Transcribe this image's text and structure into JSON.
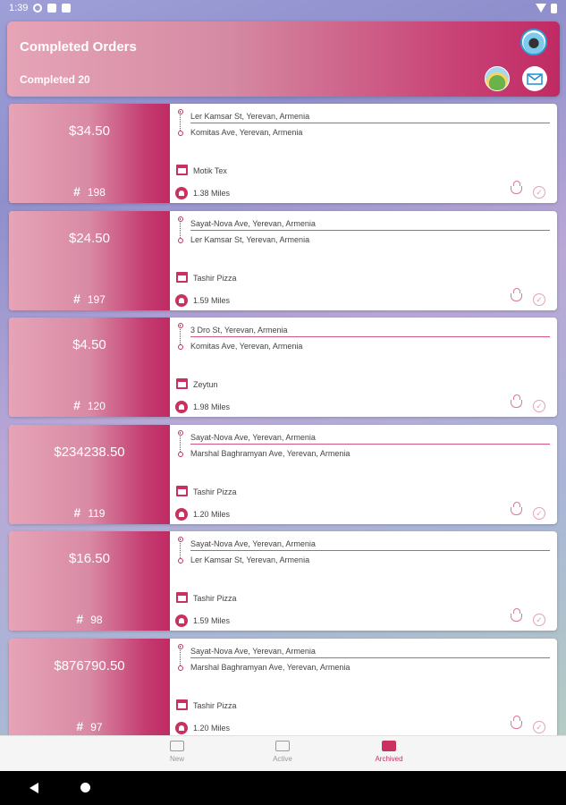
{
  "status_bar": {
    "time": "1:39"
  },
  "header": {
    "title": "Completed Orders",
    "completed_label": "Completed 20"
  },
  "orders": [
    {
      "price": "$34.50",
      "number": "198",
      "from": "Ler Kamsar St, Yerevan, Armenia",
      "to": "Komitas Ave, Yerevan, Armenia",
      "store": "Motik Tex",
      "distance": "1.38 Miles"
    },
    {
      "price": "$24.50",
      "number": "197",
      "from": "Sayat-Nova Ave, Yerevan, Armenia",
      "to": "Ler Kamsar St, Yerevan, Armenia",
      "store": "Tashir Pizza",
      "distance": "1.59 Miles"
    },
    {
      "price": "$4.50",
      "number": "120",
      "from": "3 Dro St, Yerevan, Armenia",
      "to": "Komitas Ave, Yerevan, Armenia",
      "store": "Zeytun",
      "distance": "1.98 Miles"
    },
    {
      "price": "$234238.50",
      "number": "119",
      "from": "Sayat-Nova Ave, Yerevan, Armenia",
      "to": "Marshal Baghramyan Ave, Yerevan, Armenia",
      "store": "Tashir Pizza",
      "distance": "1.20 Miles"
    },
    {
      "price": "$16.50",
      "number": "98",
      "from": "Sayat-Nova Ave, Yerevan, Armenia",
      "to": "Ler Kamsar St, Yerevan, Armenia",
      "store": "Tashir Pizza",
      "distance": "1.59 Miles"
    },
    {
      "price": "$876790.50",
      "number": "97",
      "from": "Sayat-Nova Ave, Yerevan, Armenia",
      "to": "Marshal Baghramyan Ave, Yerevan, Armenia",
      "store": "Tashir Pizza",
      "distance": "1.20 Miles"
    }
  ],
  "order_hash_symbol": "#",
  "bottom_nav": [
    {
      "label": "New",
      "icon": "truck-icon",
      "active": false
    },
    {
      "label": "Active",
      "icon": "map-icon",
      "active": false
    },
    {
      "label": "Archived",
      "icon": "archive-box-icon",
      "active": true
    }
  ],
  "colors": {
    "accent": "#c9325f",
    "header_start": "#e6a4b7",
    "header_end": "#c02a63"
  }
}
